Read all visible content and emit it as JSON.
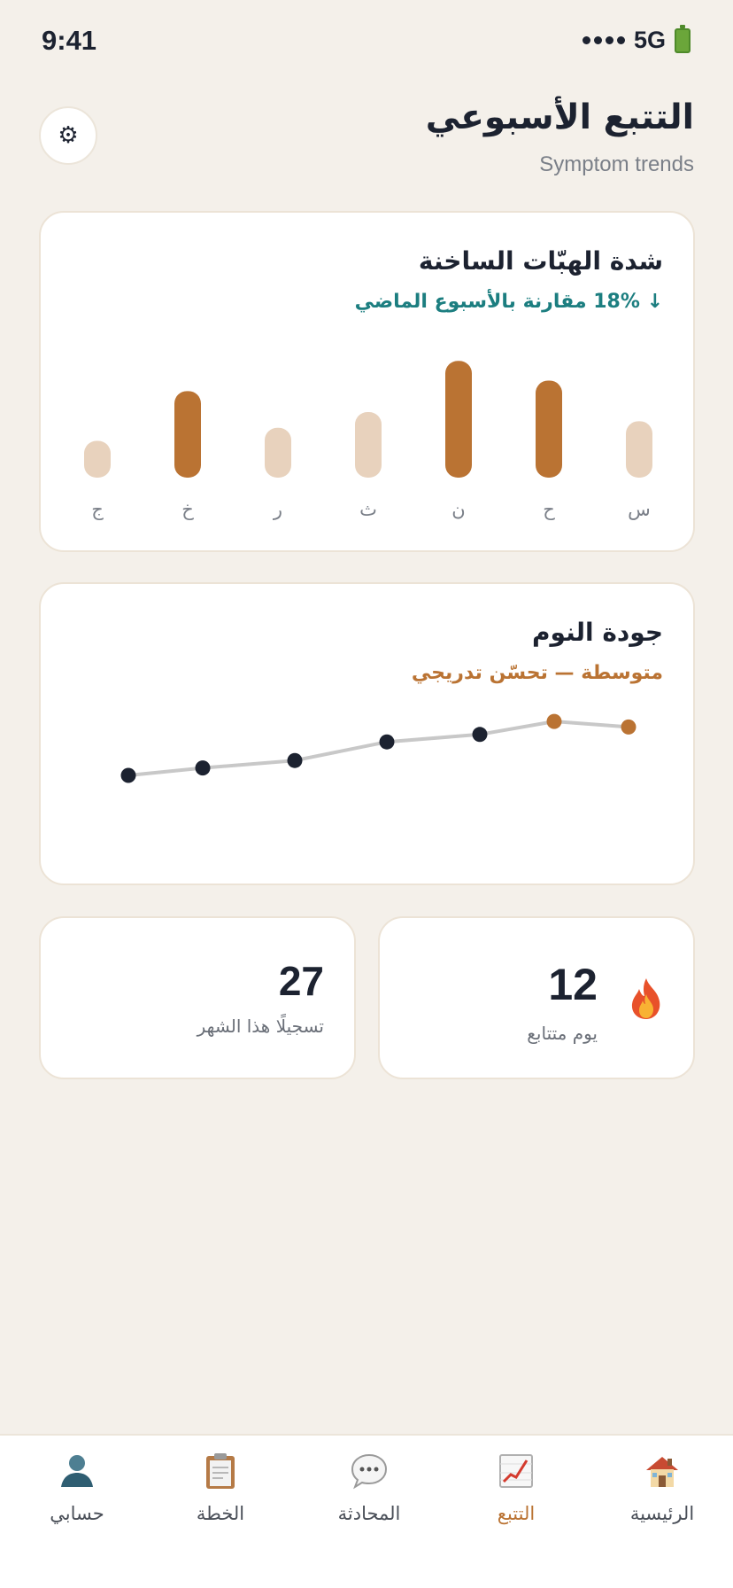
{
  "status_bar": {
    "time": "9:41",
    "network": "5G"
  },
  "header": {
    "title": "التتبع الأسبوعي",
    "subtitle": "Symptom trends"
  },
  "colors": {
    "background": "#F4F0EA",
    "accent": "#BA7333",
    "bar_light": "#E8D2BD",
    "teal": "#1C7E80",
    "ink": "#1C2230",
    "line_gray": "#C8C8C8"
  },
  "hot_flashes": {
    "title": "شدة الهبّات الساخنة",
    "subtitle": "↓ 18% مقارنة بالأسبوع الماضي"
  },
  "sleep": {
    "title": "جودة النوم",
    "subtitle": "متوسطة — تحسّن تدريجي"
  },
  "chart_data": [
    {
      "type": "bar",
      "title": "شدة الهبّات الساخنة",
      "categories": [
        "س",
        "ح",
        "ن",
        "ث",
        "ر",
        "خ",
        "ج"
      ],
      "values": [
        4.3,
        7.4,
        8.9,
        5.0,
        3.8,
        6.6,
        2.8
      ],
      "highlighted": [
        false,
        true,
        true,
        false,
        false,
        true,
        false
      ],
      "ylim": [
        0,
        10
      ],
      "grid": false,
      "legend": "none"
    },
    {
      "type": "line",
      "title": "جودة النوم",
      "x": [
        1,
        2,
        3,
        4,
        5,
        6,
        7
      ],
      "values": [
        6.6,
        6.9,
        6.2,
        5.8,
        4.8,
        4.4,
        4.0
      ],
      "highlighted": [
        true,
        true,
        false,
        false,
        false,
        false,
        false
      ],
      "ylim": [
        0,
        10
      ],
      "grid": false,
      "legend": "none"
    }
  ],
  "stats": {
    "streak": {
      "value": "12",
      "label": "يوم متتابع",
      "icon": "flame-icon"
    },
    "logs": {
      "value": "27",
      "label": "تسجيلًا هذا الشهر"
    }
  },
  "tabs": [
    {
      "label": "الرئيسية",
      "icon": "home-icon"
    },
    {
      "label": "التتبع",
      "icon": "chart-icon",
      "active": true
    },
    {
      "label": "المحادثة",
      "icon": "chat-icon"
    },
    {
      "label": "الخطة",
      "icon": "clipboard-icon"
    },
    {
      "label": "حسابي",
      "icon": "profile-icon"
    }
  ]
}
